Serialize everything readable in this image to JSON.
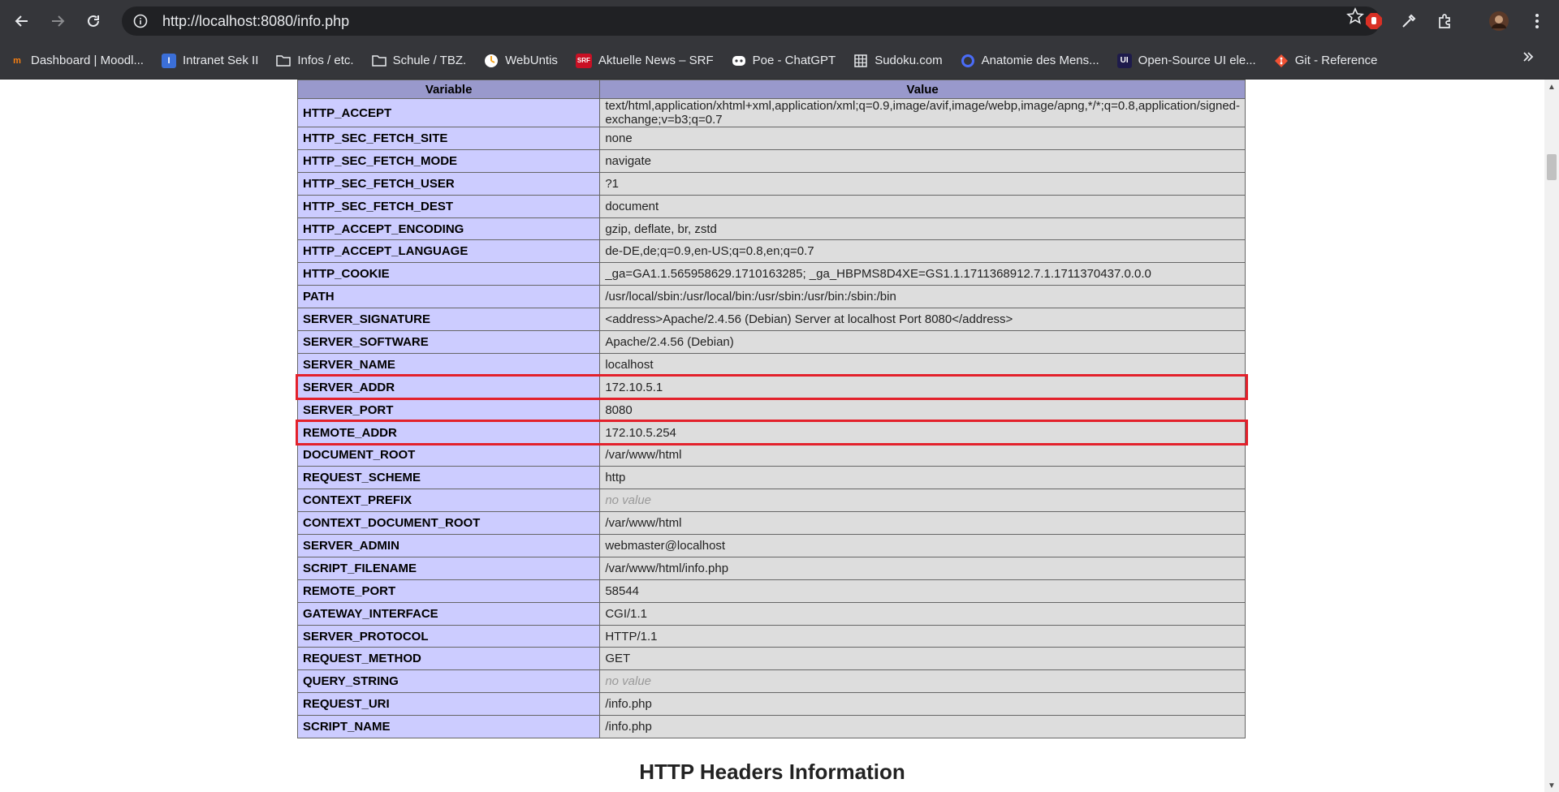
{
  "browser": {
    "url": "http://localhost:8080/info.php",
    "bookmarks": [
      {
        "label": "Dashboard | Moodl...",
        "icon": "moodle-icon"
      },
      {
        "label": "Intranet Sek II",
        "icon": "intranet-icon"
      },
      {
        "label": "Infos / etc.",
        "icon": "folder-icon"
      },
      {
        "label": "Schule / TBZ.",
        "icon": "folder-icon"
      },
      {
        "label": "WebUntis",
        "icon": "webuntis-icon"
      },
      {
        "label": "Aktuelle News – SRF",
        "icon": "srf-icon"
      },
      {
        "label": "Poe - ChatGPT",
        "icon": "poe-icon"
      },
      {
        "label": "Sudoku.com",
        "icon": "sudoku-icon"
      },
      {
        "label": "Anatomie des Mens...",
        "icon": "anatomie-icon"
      },
      {
        "label": "Open-Source UI ele...",
        "icon": "ui-icon"
      },
      {
        "label": "Git - Reference",
        "icon": "git-icon"
      }
    ]
  },
  "table": {
    "header_variable": "Variable",
    "header_value": "Value",
    "rows": [
      {
        "name": "HTTP_ACCEPT",
        "value": "text/html,application/xhtml+xml,application/xml;q=0.9,image/avif,image/webp,image/apng,*/*;q=0.8,application/signed-exchange;v=b3;q=0.7"
      },
      {
        "name": "HTTP_SEC_FETCH_SITE",
        "value": "none"
      },
      {
        "name": "HTTP_SEC_FETCH_MODE",
        "value": "navigate"
      },
      {
        "name": "HTTP_SEC_FETCH_USER",
        "value": "?1"
      },
      {
        "name": "HTTP_SEC_FETCH_DEST",
        "value": "document"
      },
      {
        "name": "HTTP_ACCEPT_ENCODING",
        "value": "gzip, deflate, br, zstd"
      },
      {
        "name": "HTTP_ACCEPT_LANGUAGE",
        "value": "de-DE,de;q=0.9,en-US;q=0.8,en;q=0.7"
      },
      {
        "name": "HTTP_COOKIE",
        "value": "_ga=GA1.1.565958629.1710163285; _ga_HBPMS8D4XE=GS1.1.1711368912.7.1.1711370437.0.0.0"
      },
      {
        "name": "PATH",
        "value": "/usr/local/sbin:/usr/local/bin:/usr/sbin:/usr/bin:/sbin:/bin"
      },
      {
        "name": "SERVER_SIGNATURE",
        "value": "<address>Apache/2.4.56 (Debian) Server at localhost Port 8080</address>"
      },
      {
        "name": "SERVER_SOFTWARE",
        "value": "Apache/2.4.56 (Debian)"
      },
      {
        "name": "SERVER_NAME",
        "value": "localhost"
      },
      {
        "name": "SERVER_ADDR",
        "value": "172.10.5.1"
      },
      {
        "name": "SERVER_PORT",
        "value": "8080"
      },
      {
        "name": "REMOTE_ADDR",
        "value": "172.10.5.254"
      },
      {
        "name": "DOCUMENT_ROOT",
        "value": "/var/www/html"
      },
      {
        "name": "REQUEST_SCHEME",
        "value": "http"
      },
      {
        "name": "CONTEXT_PREFIX",
        "value": "no value"
      },
      {
        "name": "CONTEXT_DOCUMENT_ROOT",
        "value": "/var/www/html"
      },
      {
        "name": "SERVER_ADMIN",
        "value": "webmaster@localhost"
      },
      {
        "name": "SCRIPT_FILENAME",
        "value": "/var/www/html/info.php"
      },
      {
        "name": "REMOTE_PORT",
        "value": "58544"
      },
      {
        "name": "GATEWAY_INTERFACE",
        "value": "CGI/1.1"
      },
      {
        "name": "SERVER_PROTOCOL",
        "value": "HTTP/1.1"
      },
      {
        "name": "REQUEST_METHOD",
        "value": "GET"
      },
      {
        "name": "QUERY_STRING",
        "value": "no value"
      },
      {
        "name": "REQUEST_URI",
        "value": "/info.php"
      },
      {
        "name": "SCRIPT_NAME",
        "value": "/info.php"
      }
    ]
  },
  "section_heading": "HTTP Headers Information",
  "colors": {
    "header_bg": "#9999cc",
    "name_cell_bg": "#ccccff",
    "value_cell_bg": "#dddddd",
    "highlight": "#e3212b"
  }
}
